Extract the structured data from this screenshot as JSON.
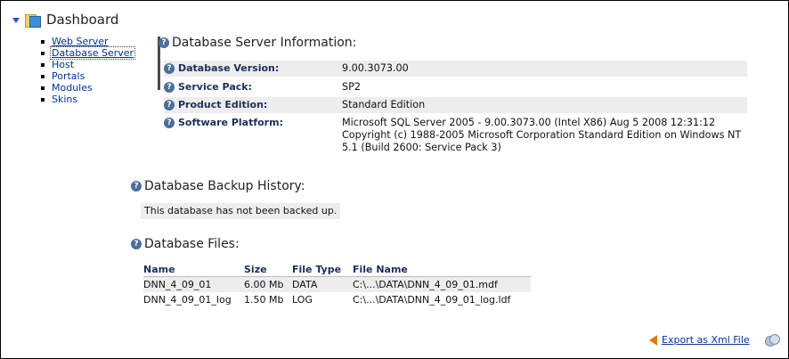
{
  "dashboard": {
    "title": "Dashboard"
  },
  "sidebar": {
    "items": [
      {
        "label": "Web Server"
      },
      {
        "label": "Database Server"
      },
      {
        "label": "Host"
      },
      {
        "label": "Portals"
      },
      {
        "label": "Modules"
      },
      {
        "label": "Skins"
      }
    ]
  },
  "server_info": {
    "title": "Database Server Information:",
    "rows": [
      {
        "label": "Database Version:",
        "value": "9.00.3073.00"
      },
      {
        "label": "Service Pack:",
        "value": "SP2"
      },
      {
        "label": "Product Edition:",
        "value": "Standard Edition"
      },
      {
        "label": "Software Platform:",
        "value": "Microsoft SQL Server 2005 - 9.00.3073.00 (Intel X86) Aug 5 2008 12:31:12 Copyright (c) 1988-2005 Microsoft Corporation Standard Edition on Windows NT 5.1 (Build 2600: Service Pack 3)"
      }
    ]
  },
  "backup": {
    "title": "Database Backup History:",
    "message": "This database has not been backed up."
  },
  "files": {
    "title": "Database Files:",
    "columns": [
      "Name",
      "Size",
      "File Type",
      "File Name"
    ],
    "rows": [
      [
        "DNN_4_09_01",
        "6.00 Mb",
        "DATA",
        "C:\\...\\DATA\\DNN_4_09_01.mdf"
      ],
      [
        "DNN_4_09_01_log",
        "1.50 Mb",
        "LOG",
        "C:\\...\\DATA\\DNN_4_09_01_log.ldf"
      ]
    ]
  },
  "export": {
    "label": "Export as Xml File"
  },
  "icons": {
    "help": "help-icon",
    "folder": "folder-icon",
    "export_arrow": "arrow-left-icon",
    "database": "database-icon"
  }
}
